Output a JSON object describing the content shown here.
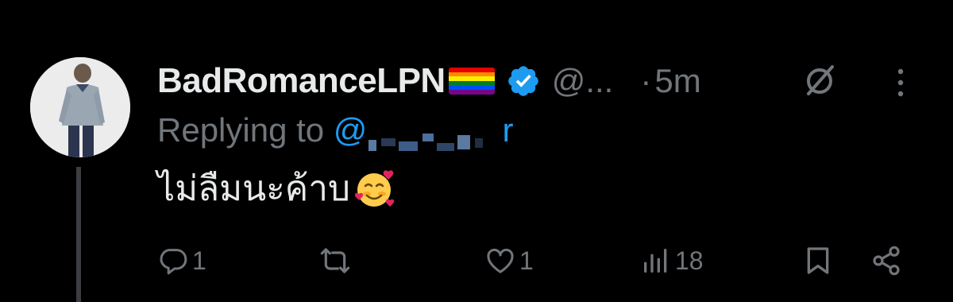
{
  "tweet": {
    "display_name": "BadRomanceLPN",
    "flag_emoji_name": "rainbow-flag",
    "verified": true,
    "handle": "@...",
    "separator": "·",
    "time": "5m",
    "replying_label": "Replying to",
    "replying_mention": "@",
    "replying_mention_tail": "r",
    "text": "ไม่ลืมนะค้าบ",
    "text_emoji_name": "smiling-face-with-hearts"
  },
  "actions": {
    "reply_count": "1",
    "retweet_count": "",
    "like_count": "1",
    "views_count": "18"
  },
  "colors": {
    "background": "#000000",
    "primary_text": "#e7e9ea",
    "secondary_text": "#71767b",
    "accent": "#1d9bf0"
  }
}
